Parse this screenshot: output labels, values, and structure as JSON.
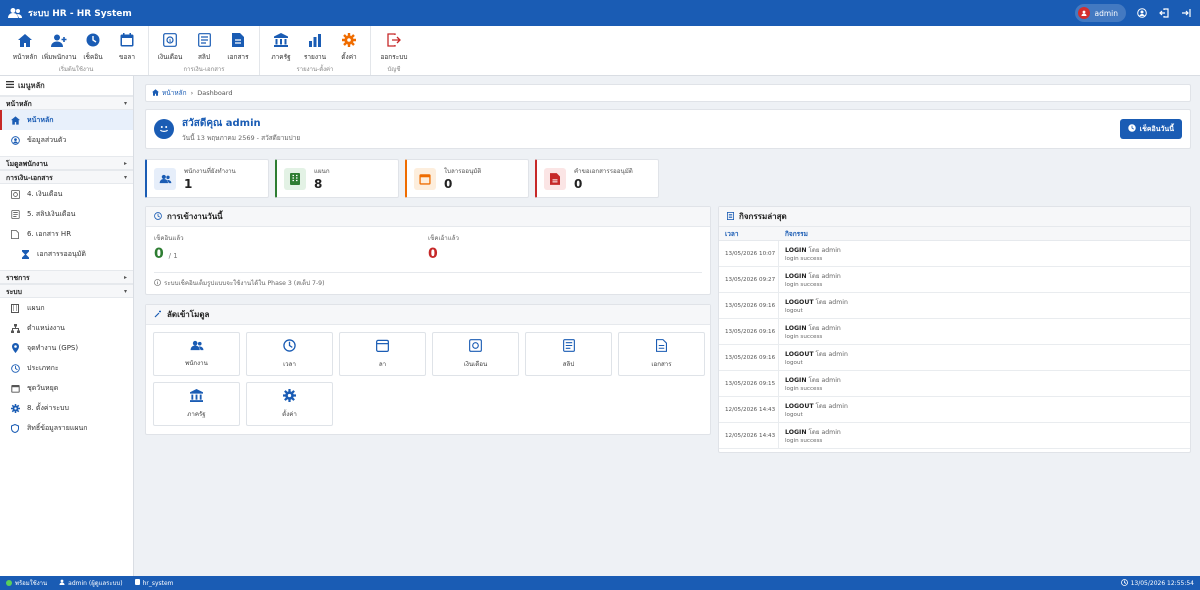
{
  "titlebar": {
    "title": "ระบบ HR - HR System",
    "user": "admin"
  },
  "ribbon": {
    "groups": [
      {
        "label": "เริ่มต้นใช้งาน",
        "buttons": [
          {
            "label": "หน้าหลัก",
            "icon": "home-icon"
          },
          {
            "label": "เพิ่มพนักงาน",
            "icon": "add-user-icon"
          },
          {
            "label": "เช็คอิน",
            "icon": "clock-icon"
          },
          {
            "label": "ขอลา",
            "icon": "calendar-icon"
          }
        ]
      },
      {
        "label": "การเงิน-เอกสาร",
        "buttons": [
          {
            "label": "เงินเดือน",
            "icon": "salary-icon"
          },
          {
            "label": "สลิป",
            "icon": "slip-icon"
          },
          {
            "label": "เอกสาร",
            "icon": "document-icon"
          }
        ]
      },
      {
        "label": "รายงาน-ตั้งค่า",
        "buttons": [
          {
            "label": "ภาครัฐ",
            "icon": "government-icon"
          },
          {
            "label": "รายงาน",
            "icon": "chart-icon"
          },
          {
            "label": "ตั้งค่า",
            "icon": "gear-icon"
          }
        ]
      },
      {
        "label": "บัญชี",
        "buttons": [
          {
            "label": "ออกระบบ",
            "icon": "logout-icon"
          }
        ]
      }
    ]
  },
  "sidebar": {
    "header": "เมนูหลัก",
    "sections": [
      {
        "title": "หน้าหลัก",
        "items": [
          "หน้าหลัก",
          "ข้อมูลส่วนตัว"
        ]
      },
      {
        "title": "โมดูลพนักงาน",
        "items": []
      },
      {
        "title": "การเงิน-เอกสาร",
        "items": [
          "4. เงินเดือน",
          "5. สลิปเงินเดือน",
          "6. เอกสาร HR",
          "เอกสารรออนุมัติ"
        ]
      },
      {
        "title": "ราชการ",
        "items": []
      },
      {
        "title": "ระบบ",
        "items": [
          "แผนก",
          "ตำแหน่งงาน",
          "จุดทำงาน (GPS)",
          "ประเภทกะ",
          "ชุดวันหยุด",
          "8. ตั้งค่าระบบ",
          "สิทธิ์ข้อมูลรายแผนก"
        ]
      }
    ]
  },
  "breadcrumb": {
    "home": "หน้าหลัก",
    "current": "Dashboard"
  },
  "greeting": {
    "title": "สวัสดีคุณ admin",
    "subtitle": "วันนี้ 13 พฤษภาคม 2569 - สวัสดียามบ่าย",
    "checkin_label": "เช็คอินวันนี้"
  },
  "stats": [
    {
      "label": "พนักงานที่ยังทำงาน",
      "value": "1",
      "color": "#1a5cb4"
    },
    {
      "label": "แผนก",
      "value": "8",
      "color": "#2e7d32"
    },
    {
      "label": "ใบลารออนุมัติ",
      "value": "0",
      "color": "#ef6c00"
    },
    {
      "label": "คำขอเอกสารรออนุมัติ",
      "value": "0",
      "color": "#c62828"
    }
  ],
  "attendance": {
    "title": "การเข้างานวันนี้",
    "checked_in_label": "เช็คอินแล้ว",
    "checked_in_value": "0",
    "checked_in_total": "/ 1",
    "checked_out_label": "เช็คเอ้าแล้ว",
    "checked_out_value": "0",
    "note": "ระบบเช็คอินเต็มรูปแบบจะใช้งานได้ใน Phase 3 (สเต็ป 7-9)"
  },
  "shortcuts": {
    "title": "ลัดเข้าโมดูล",
    "items": [
      "พนักงาน",
      "เวลา",
      "ลา",
      "เงินเดือน",
      "สลิป",
      "เอกสาร",
      "ภาครัฐ",
      "ตั้งค่า"
    ]
  },
  "activity": {
    "title": "กิจกรรมล่าสุด",
    "col_time": "เวลา",
    "col_action": "กิจกรรม",
    "by_text": "โดย admin",
    "rows": [
      {
        "time": "13/05/2026 10:07",
        "action": "LOGIN",
        "detail": "login success"
      },
      {
        "time": "13/05/2026 09:27",
        "action": "LOGIN",
        "detail": "login success"
      },
      {
        "time": "13/05/2026 09:16",
        "action": "LOGOUT",
        "detail": "logout"
      },
      {
        "time": "13/05/2026 09:16",
        "action": "LOGIN",
        "detail": "login success"
      },
      {
        "time": "13/05/2026 09:16",
        "action": "LOGOUT",
        "detail": "logout"
      },
      {
        "time": "13/05/2026 09:15",
        "action": "LOGIN",
        "detail": "login success"
      },
      {
        "time": "12/05/2026 14:43",
        "action": "LOGOUT",
        "detail": "logout"
      },
      {
        "time": "12/05/2026 14:43",
        "action": "LOGIN",
        "detail": "login success"
      }
    ]
  },
  "statusbar": {
    "ready": "พร้อมใช้งาน",
    "user": "admin (ผู้ดูแลระบบ)",
    "db": "hr_system",
    "datetime": "13/05/2026 12:55:54"
  },
  "colors": {
    "primary": "#1a5cb4",
    "accent_red": "#c62828",
    "success": "#2e7d32",
    "warning": "#ef6c00"
  }
}
